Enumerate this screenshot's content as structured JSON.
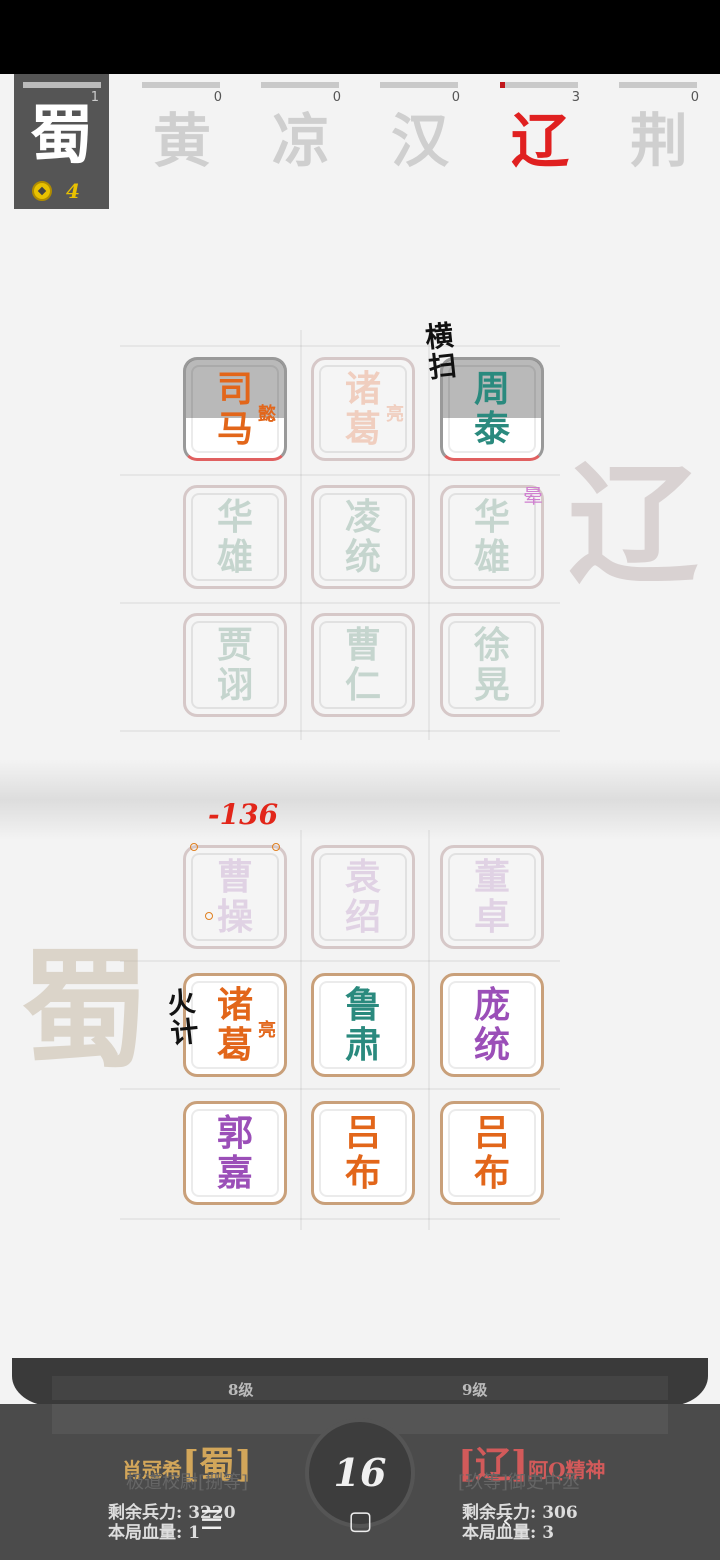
{
  "factions": {
    "active": {
      "name": "蜀",
      "count": "1",
      "gold": "4"
    },
    "others": [
      {
        "name": "黄",
        "count": "0",
        "progress": 0
      },
      {
        "name": "凉",
        "count": "0",
        "progress": 0
      },
      {
        "name": "汉",
        "count": "0",
        "progress": 0
      },
      {
        "name": "辽",
        "count": "3",
        "progress": 0.06,
        "enemy": true
      },
      {
        "name": "荆",
        "count": "0",
        "progress": 0
      }
    ]
  },
  "enemy_board": [
    {
      "name": "司马",
      "sub": "懿",
      "color": "orange",
      "state": "hit"
    },
    {
      "name": "诸葛",
      "sub": "亮",
      "color": "peach",
      "state": "faded"
    },
    {
      "name": "周泰",
      "sub": "",
      "color": "teal",
      "state": "hit"
    },
    {
      "name": "华雄",
      "sub": "",
      "color": "green",
      "state": "faded"
    },
    {
      "name": "凌统",
      "sub": "",
      "color": "green",
      "state": "faded"
    },
    {
      "name": "华雄",
      "sub": "",
      "color": "green",
      "state": "faded"
    },
    {
      "name": "贾诩",
      "sub": "",
      "color": "green",
      "state": "faded"
    },
    {
      "name": "曹仁",
      "sub": "",
      "color": "green",
      "state": "faded"
    },
    {
      "name": "徐晃",
      "sub": "",
      "color": "green",
      "state": "faded"
    }
  ],
  "player_board": [
    {
      "name": "曹操",
      "sub": "",
      "color": "lav",
      "state": "faded"
    },
    {
      "name": "袁绍",
      "sub": "",
      "color": "lav",
      "state": "faded"
    },
    {
      "name": "董卓",
      "sub": "",
      "color": "lav",
      "state": "faded"
    },
    {
      "name": "诸葛",
      "sub": "亮",
      "color": "orange",
      "state": "player"
    },
    {
      "name": "鲁肃",
      "sub": "",
      "color": "teal",
      "state": "player"
    },
    {
      "name": "庞统",
      "sub": "",
      "color": "purple",
      "state": "player"
    },
    {
      "name": "郭嘉",
      "sub": "",
      "color": "purple",
      "state": "player"
    },
    {
      "name": "吕布",
      "sub": "",
      "color": "orange",
      "state": "player"
    },
    {
      "name": "吕布",
      "sub": "",
      "color": "orange",
      "state": "player"
    }
  ],
  "effects": {
    "enemy_skill": "横扫",
    "player_skill": "火计",
    "damage": "-136",
    "dizzy": "晕"
  },
  "background": {
    "enemy_glyph": "辽",
    "player_glyph": "蜀"
  },
  "bottom": {
    "left_level": "8级",
    "right_level": "9级",
    "turn": "16",
    "player": {
      "name": "肖冠希",
      "faction": "[蜀]",
      "rank": "极道校尉[捌等]",
      "troops_label": "剩余兵力:",
      "troops": "3220",
      "hp_label": "本局血量:",
      "hp": "1"
    },
    "enemy": {
      "name": "阿Q精神",
      "faction": "[辽]",
      "rank": "[玖等]御史中丞",
      "troops_label": "剩余兵力:",
      "troops": "306",
      "hp_label": "本局血量:",
      "hp": "3"
    }
  },
  "colors": {
    "orange": "#e2661a",
    "teal": "#2a8a7e",
    "purple": "#9b4fb8",
    "green": "#8cb0a0",
    "peach": "#eba07f",
    "lav": "#c8a8d0",
    "enemy_red": "#e02020"
  }
}
